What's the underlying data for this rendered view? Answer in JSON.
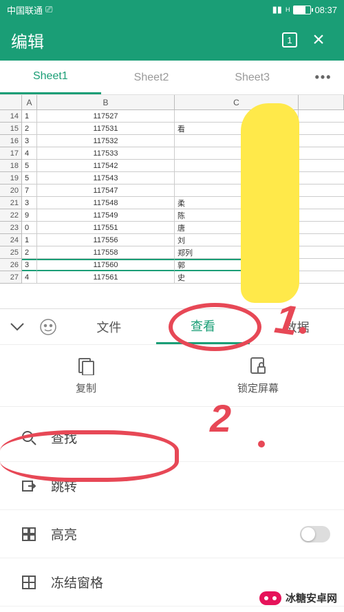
{
  "status": {
    "carrier": "中国联通",
    "time": "08:37"
  },
  "header": {
    "title": "编辑",
    "tab_count": "1"
  },
  "sheets": {
    "tabs": [
      "Sheet1",
      "Sheet2",
      "Sheet3"
    ],
    "active": 0,
    "more": "•••"
  },
  "columns": [
    "A",
    "B",
    "C"
  ],
  "rows": [
    {
      "n": "14",
      "a": "1",
      "b": "117527",
      "c": ""
    },
    {
      "n": "15",
      "a": "2",
      "b": "117531",
      "c": "看"
    },
    {
      "n": "16",
      "a": "3",
      "b": "117532",
      "c": ""
    },
    {
      "n": "17",
      "a": "4",
      "b": "117533",
      "c": ""
    },
    {
      "n": "18",
      "a": "5",
      "b": "117542",
      "c": ""
    },
    {
      "n": "19",
      "a": "5",
      "b": "117543",
      "c": ""
    },
    {
      "n": "20",
      "a": "7",
      "b": "117547",
      "c": ""
    },
    {
      "n": "21",
      "a": "3",
      "b": "117548",
      "c": "柔"
    },
    {
      "n": "22",
      "a": "9",
      "b": "117549",
      "c": "陈"
    },
    {
      "n": "23",
      "a": "0",
      "b": "117551",
      "c": "唐"
    },
    {
      "n": "24",
      "a": "1",
      "b": "117556",
      "c": "刘"
    },
    {
      "n": "25",
      "a": "2",
      "b": "117558",
      "c": "郑列"
    },
    {
      "n": "26",
      "a": "3",
      "b": "117560",
      "c": "郭"
    },
    {
      "n": "27",
      "a": "4",
      "b": "117561",
      "c": "史"
    }
  ],
  "selected_row": 12,
  "panel": {
    "tabs": {
      "file": "文件",
      "view": "查看",
      "data": "数据"
    },
    "actions": {
      "copy": "复制",
      "lock": "锁定屏幕"
    },
    "menu": {
      "find": "查找",
      "goto": "跳转",
      "highlight": "高亮",
      "freeze": "冻结窗格"
    }
  },
  "watermark": "冰糖安卓网",
  "annotations": {
    "label1": "1",
    "label2": "2"
  }
}
